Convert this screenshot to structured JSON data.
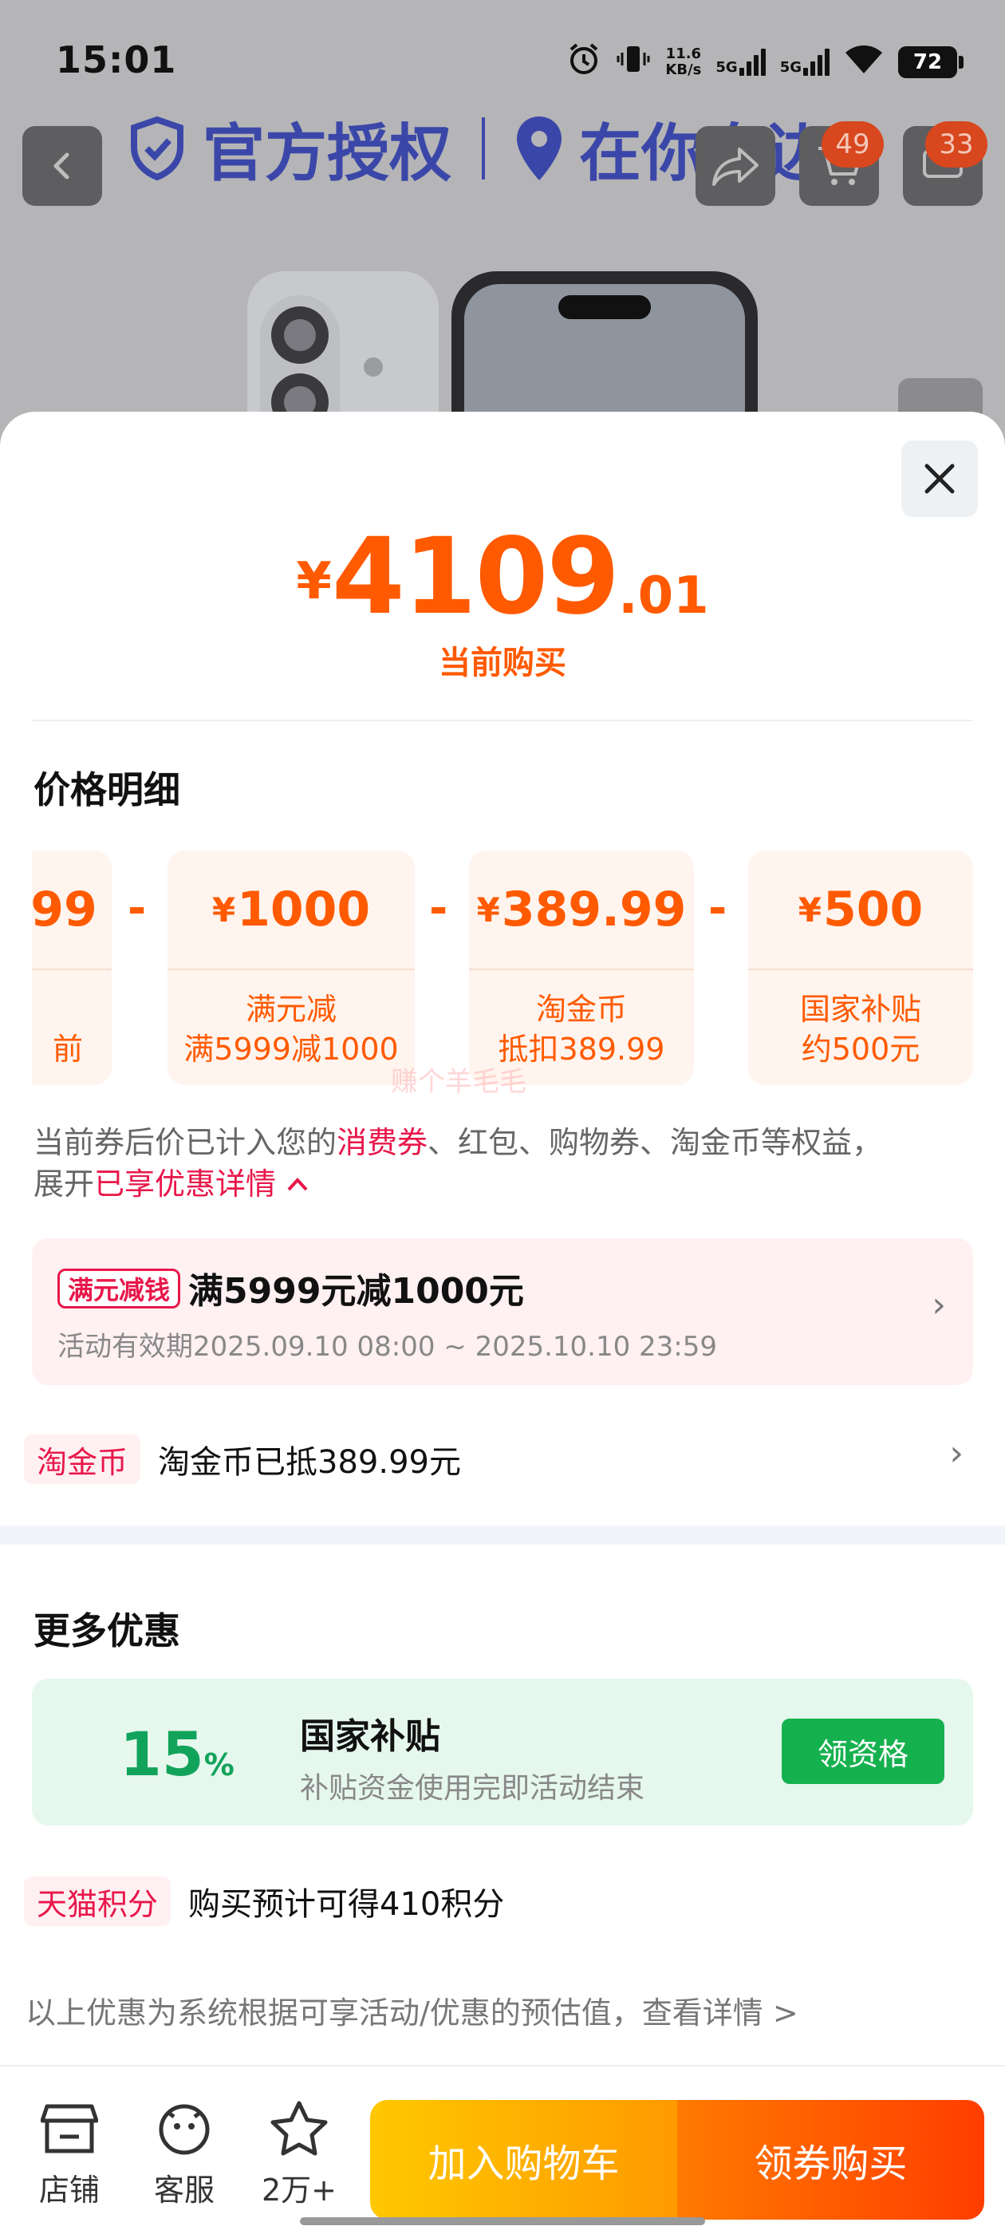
{
  "status_bar": {
    "time": "15:01",
    "net_speed_value": "11.6",
    "net_speed_unit": "KB/s",
    "sim1": "5G",
    "sim2": "5G",
    "battery": "72"
  },
  "header": {
    "banner_left": "官方授权",
    "banner_right": "在你身边",
    "cart_badge": "49",
    "msg_badge": "33"
  },
  "price": {
    "currency": "¥",
    "integer": "4109",
    "decimal": ".01",
    "caption": "当前购买"
  },
  "breakdown": {
    "title": "价格明细",
    "cards": [
      {
        "amount": "99",
        "line1": "",
        "line2": "前",
        "partial": true
      },
      {
        "amount": "1000",
        "line1": "满元减",
        "line2": "满5999减1000"
      },
      {
        "amount": "389.99",
        "line1": "淘金币",
        "line2": "抵扣389.99"
      },
      {
        "amount": "500",
        "line1": "国家补贴",
        "line2": "约500元"
      }
    ],
    "operator": "-"
  },
  "watermark": "赚个羊毛毛",
  "note": {
    "part1": "当前券后价已计入您的",
    "highlight1": "消费券",
    "part2": "、红包、购物券、淘金币等权益，",
    "part3": "展开",
    "highlight2": "已享优惠详情"
  },
  "coupon": {
    "tag": "满元减钱",
    "title": "满5999元减1000元",
    "validity": "活动有效期2025.09.10 08:00 ~ 2025.10.10 23:59"
  },
  "taojinbi": {
    "tag": "淘金币",
    "text": "淘金币已抵389.99元"
  },
  "more": {
    "title": "更多优惠",
    "subsidy": {
      "pct": "15",
      "pct_unit": "%",
      "title": "国家补贴",
      "subtitle": "补贴资金使用完即活动结束",
      "button": "领资格"
    },
    "points": {
      "tag": "天猫积分",
      "text": "购买预计可得410积分"
    }
  },
  "disclaimer": "以上优惠为系统根据可享活动/优惠的预估值，查看详情 >",
  "bottom_bar": {
    "shop": "店铺",
    "service": "客服",
    "favorites": "2万+",
    "add_to_cart": "加入购物车",
    "buy": "领券购买"
  },
  "colors": {
    "accent": "#ff5a00",
    "promo_red": "#e8174a",
    "green": "#16b14f"
  }
}
